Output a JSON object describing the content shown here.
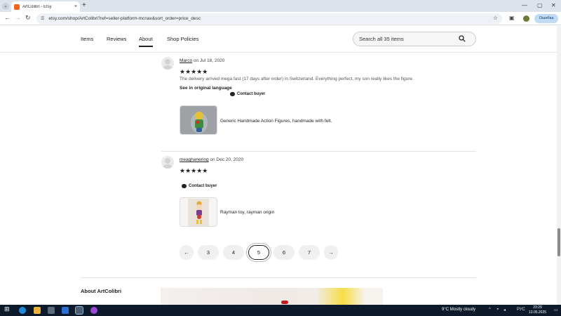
{
  "browser": {
    "tab_title": "ArtColibri - Etsy",
    "tab_close_glyph": "×",
    "new_tab_glyph": "+",
    "url": "etsy.com/shop/ArtColibri?ref=seller-platform-mcnav&sort_order=price_desc",
    "profile_label": "Ошибка",
    "icons": [
      "back-arrow-icon",
      "forward-arrow-icon",
      "reload-icon",
      "site-info-icon",
      "star-icon",
      "extensions-icon",
      "profile-avatar-icon",
      "menu-dots-icon",
      "minimize-icon",
      "maximize-icon",
      "close-icon"
    ]
  },
  "shop_nav": {
    "items": [
      "Items",
      "Reviews",
      "About",
      "Shop Policies"
    ],
    "active": "About",
    "search_placeholder": "Search all 35 items"
  },
  "reviews": [
    {
      "author": "Marco",
      "date_text": "on Jul 18, 2020",
      "stars": "★★★★★",
      "text": "The delivery arrived mega fast (17 days after order) in Switzerland. Everything perfect, my son really likes the figure.",
      "original_language_link": "See in original language",
      "contact_label": "Contact buyer",
      "item_title": "Generic Handmade Action Figures, handmade with felt."
    },
    {
      "author": "meaghanering",
      "date_text": "on Dec 20, 2020",
      "stars": "★★★★★",
      "contact_label": "Contact buyer",
      "item_title": "Rayman toy, rayman origin"
    }
  ],
  "pagination": {
    "prev_glyph": "←",
    "next_glyph": "→",
    "pages": [
      "3",
      "4",
      "5",
      "6",
      "7"
    ],
    "current": "5"
  },
  "about": {
    "heading": "About ArtColibri"
  },
  "taskbar": {
    "weather_text": "9°C  Mostly cloudy",
    "language": "РУС",
    "time": "23:29",
    "date": "13.05.2025"
  },
  "colors": {
    "etsy_orange": "#f1641e",
    "tab_strip": "#dde3ea",
    "taskbar": "#0d1a2b"
  }
}
